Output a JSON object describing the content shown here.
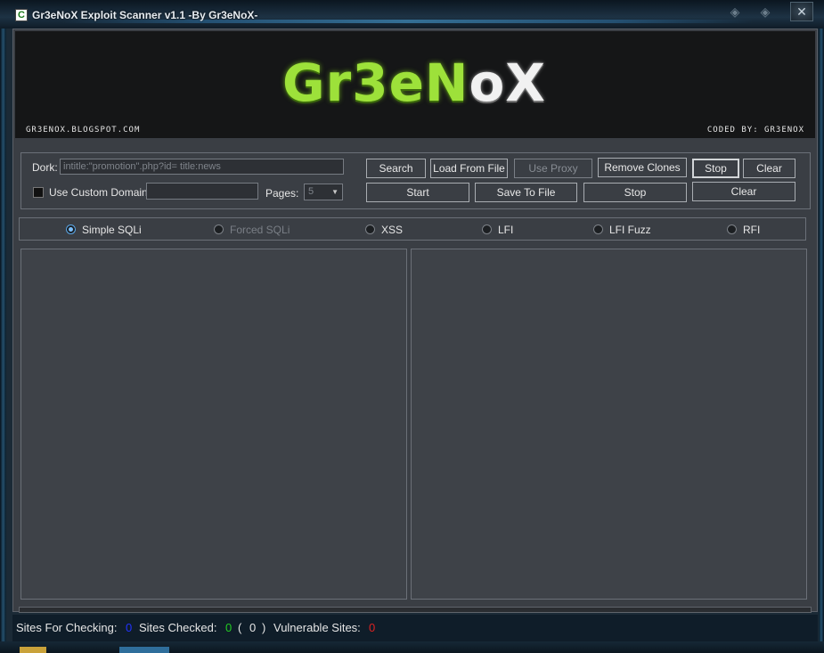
{
  "window": {
    "title": "Gr3eNoX Exploit Scanner v1.1 -By Gr3eNoX-",
    "icon_letter": "C",
    "close_glyph": "✕",
    "control_glyph": "◈"
  },
  "banner": {
    "logo_green": "Gr3eN",
    "logo_white": "oX",
    "left_text": "GR3ENOX.BLOGSPOT.COM",
    "right_text": "CODED BY: GR3ENOX"
  },
  "controls": {
    "dork_label": "Dork:",
    "dork_value": "intitle:\"promotion\".php?id= title:news",
    "custom_domain_label": "Use Custom Domain:",
    "custom_domain_value": "",
    "pages_label": "Pages:",
    "pages_value": "5"
  },
  "buttons": {
    "search": "Search",
    "load_from_file": "Load From File",
    "use_proxy": "Use Proxy",
    "remove_clones": "Remove Clones",
    "stop_top": "Stop",
    "clear_top": "Clear",
    "start": "Start",
    "save_to_file": "Save To File",
    "stop_bottom": "Stop",
    "clear_bottom": "Clear"
  },
  "modes": {
    "simple_sqli": "Simple SQLi",
    "forced_sqli": "Forced SQLi",
    "xss": "XSS",
    "lfi": "LFI",
    "lfi_fuzz": "LFI Fuzz",
    "rfi": "RFI",
    "selected": "Simple SQLi"
  },
  "status": {
    "sites_for_checking_label": "Sites For Checking:",
    "sites_for_checking_value": "0",
    "sites_checked_label": "Sites Checked:",
    "sites_checked_value": "0",
    "paren_open": "(",
    "paren_value": "0",
    "paren_close": ")",
    "vulnerable_label": "Vulnerable Sites:",
    "vulnerable_value": "0"
  },
  "colors": {
    "accent_green": "#9de13a",
    "count_blue": "#2233ff",
    "count_green": "#22cc22",
    "count_red": "#dd2222"
  }
}
